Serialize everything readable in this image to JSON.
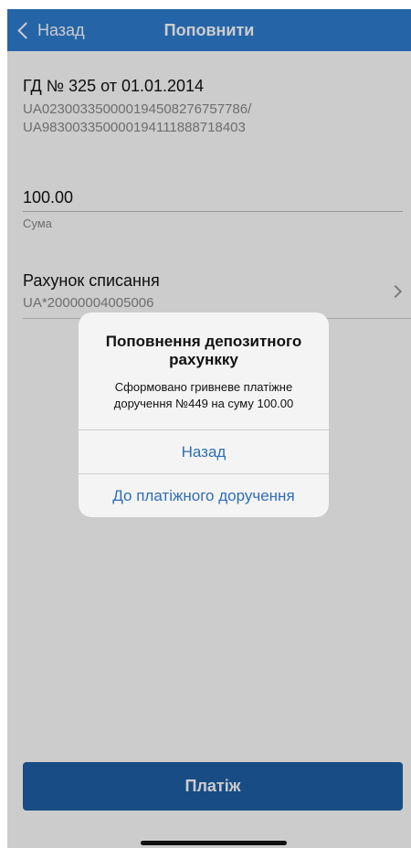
{
  "navbar": {
    "back_label": "Назад",
    "title": "Поповнити"
  },
  "deposit": {
    "title": "ГД № 325 от 01.01.2014",
    "ibans": [
      "UA023003350000194508276757786/",
      "UA983003350000194111888718403"
    ]
  },
  "amount": {
    "value": "100.00",
    "label": "Сума"
  },
  "debit_account": {
    "label": "Рахунок списання",
    "value": "UA*20000004005006"
  },
  "payment_button": {
    "label": "Платіж"
  },
  "alert": {
    "title": "Поповнення депозитного рахункку",
    "message": "Сформовано гривневе платіжне доручення №449 на суму 100.00",
    "buttons": [
      "Назад",
      "До платіжного доручення"
    ]
  },
  "colors": {
    "navbar": "#2f7fd1",
    "primary_button": "#1d5fa6",
    "alert_button_text": "#2f6db5"
  }
}
